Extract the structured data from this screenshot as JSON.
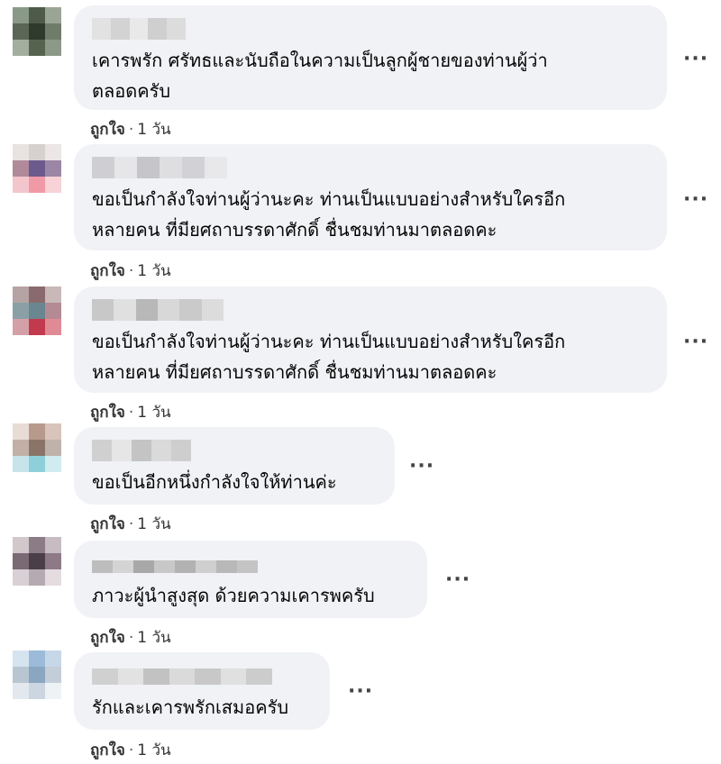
{
  "comments": [
    {
      "line1": "เคารพรัก ศรัทธและนับถือในความเป็นลูกผู้ชายของท่านผู้ว่า",
      "line2": "ตลอดครับ",
      "like_label": "ถูกใจ",
      "separator": "·",
      "time": "1 วัน",
      "more_label": "···",
      "avatar_colors": [
        "#8a9a88",
        "#4e5a4a",
        "#9aa596",
        "#5b6656",
        "#2f3a2c",
        "#6f7c6a",
        "#a3ae9e",
        "#56634f",
        "#8d9988"
      ],
      "name_colors": [
        "#e2e2e2",
        "#d3d3d3",
        "#e9e9e9",
        "#cfcfcf",
        "#dcdcdc"
      ]
    },
    {
      "line1": "ขอเป็นกำลังใจท่านผู้ว่านะคะ ท่านเป็นแบบอย่างสำหรับใครอีก",
      "line2": "หลายคน ที่มียศถาบรรดาศักดิ์ ชื่นชมท่านมาตลอดคะ",
      "like_label": "ถูกใจ",
      "separator": "·",
      "time": "1 วัน",
      "more_label": "···",
      "avatar_colors": [
        "#e8e2e0",
        "#d6d0cf",
        "#ece6e6",
        "#b08a9a",
        "#6c5a8c",
        "#9c86a6",
        "#f2c6cc",
        "#ef9aa6",
        "#f7d2d6"
      ],
      "name_colors": [
        "#cfcfd3",
        "#e6e6e8",
        "#c6c6ca",
        "#dedee0",
        "#d2d2d6",
        "#e8e8ea"
      ]
    },
    {
      "line1": "ขอเป็นกำลังใจท่านผู้ว่านะคะ ท่านเป็นแบบอย่างสำหรับใครอีก",
      "line2": "หลายคน ที่มียศถาบรรดาศักดิ์ ชื่นชมท่านมาตลอดคะ",
      "like_label": "ถูกใจ",
      "separator": "·",
      "time": "1 วัน",
      "more_label": "···",
      "avatar_colors": [
        "#b6a4a4",
        "#8a6a6e",
        "#c9b8b8",
        "#8aa0a6",
        "#6a8690",
        "#b48a94",
        "#d4a0a8",
        "#c23a4e",
        "#e08a96"
      ],
      "name_colors": [
        "#c8c8c8",
        "#e0e0e0",
        "#b8b8b8",
        "#d8d8d8",
        "#cacaca",
        "#dcdcdc"
      ]
    },
    {
      "line1": "ขอเป็นอีกหนึ่งกำลังใจให้ท่านค่ะ",
      "like_label": "ถูกใจ",
      "separator": "·",
      "time": "1 วัน",
      "more_label": "···",
      "avatar_colors": [
        "#e8dcd6",
        "#b89a8c",
        "#d8c4ba",
        "#c2b0a6",
        "#8a7468",
        "#bfb2aa",
        "#c6e4ea",
        "#8ed0da",
        "#d0ecf0"
      ],
      "name_colors": [
        "#d0d0d0",
        "#e6e6e6",
        "#c4c4c4",
        "#dadada",
        "#cecece"
      ]
    },
    {
      "line1": "ภาวะผู้นำสูงสุด ด้วยความเคารพครับ",
      "like_label": "ถูกใจ",
      "separator": "·",
      "time": "1 วัน",
      "more_label": "···",
      "avatar_colors": [
        "#d2c8cc",
        "#8c7c86",
        "#c6bcc2",
        "#7a6a74",
        "#4a3e48",
        "#8e7a86",
        "#d8d0d4",
        "#b6aab2",
        "#e4dcdf"
      ],
      "name_colors": [
        "#bdbdbd",
        "#d4d4d4",
        "#a8a8a8",
        "#c8c8c8",
        "#b2b2b2",
        "#cfcfcf",
        "#b8b8b8",
        "#c4c4c4"
      ]
    },
    {
      "line1": "รักและเคารพรักเสมอครับ",
      "like_label": "ถูกใจ",
      "separator": "·",
      "time": "1 วัน",
      "more_label": "···",
      "avatar_colors": [
        "#d6e4f0",
        "#9cbbd8",
        "#c6d8e8",
        "#b8c6d2",
        "#8aa6c0",
        "#c4ced8",
        "#e2e8ee",
        "#cbd6e0",
        "#eef2f5"
      ],
      "name_colors": [
        "#d0d0d0",
        "#e2e2e2",
        "#c2c2c2",
        "#dadada",
        "#c8c8c8",
        "#e0e0e0",
        "#cccccc"
      ]
    }
  ]
}
